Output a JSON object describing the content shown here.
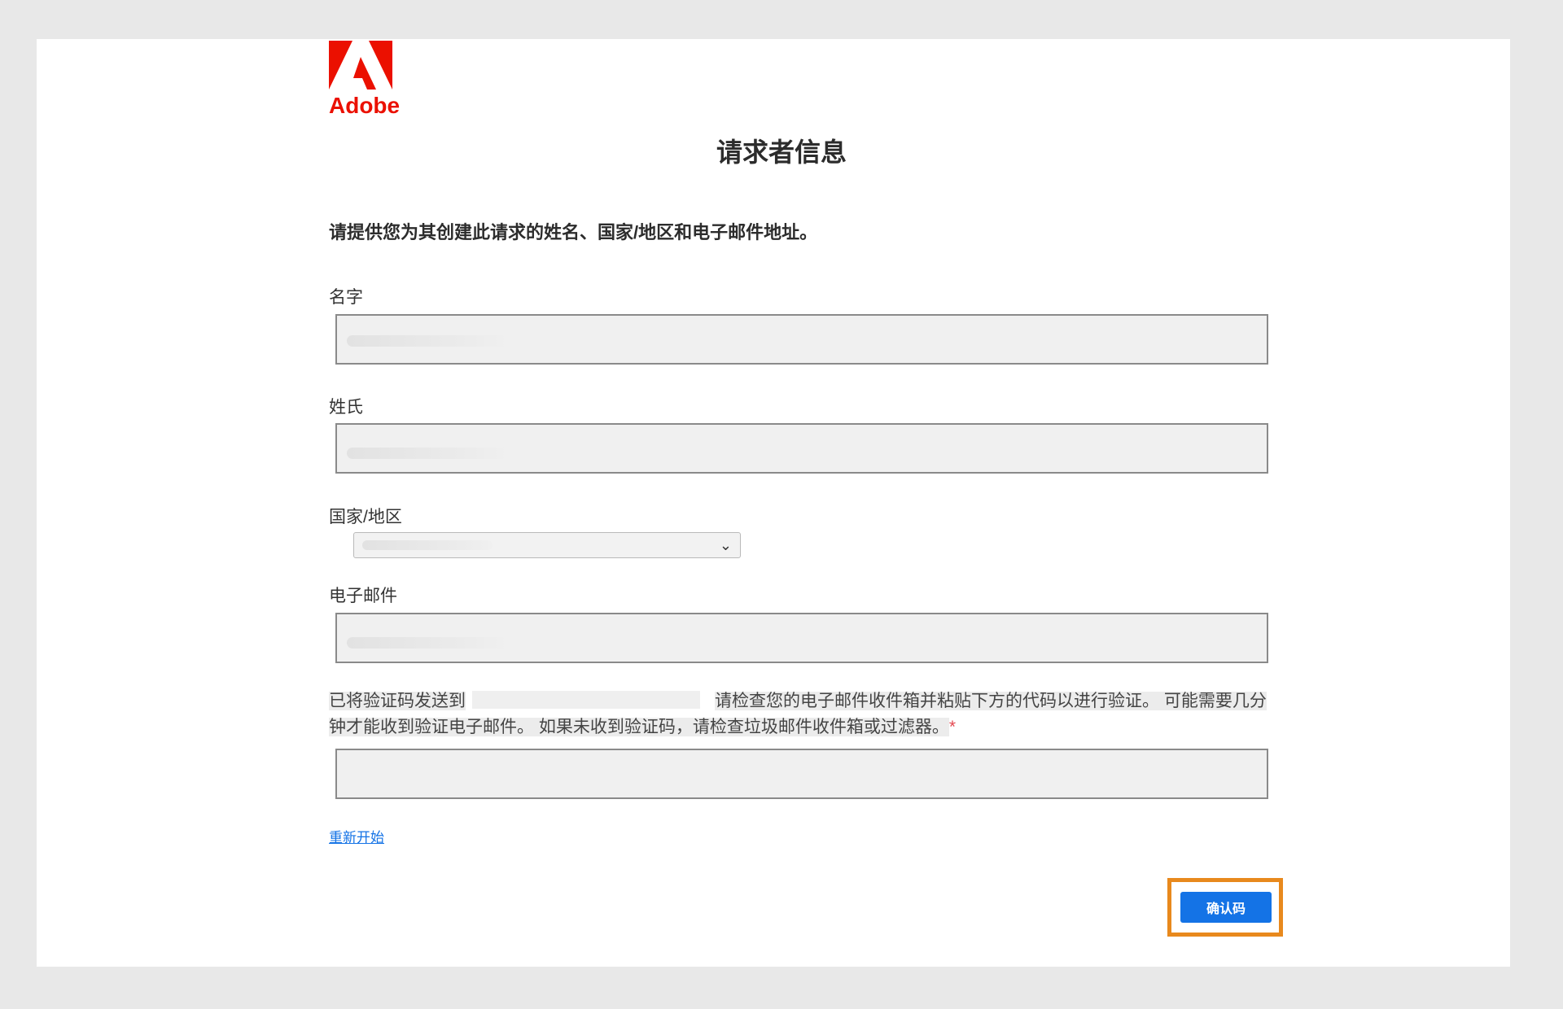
{
  "brand": {
    "name": "Adobe",
    "color": "#eb1000",
    "icon": "adobe-logo-icon"
  },
  "page": {
    "title": "请求者信息",
    "intro": "请提供您为其创建此请求的姓名、国家/地区和电子邮件地址。"
  },
  "form": {
    "first_name": {
      "label": "名字",
      "value": ""
    },
    "last_name": {
      "label": "姓氏",
      "value": ""
    },
    "country": {
      "label": "国家/地区",
      "selected": "",
      "icon": "chevron-down-icon"
    },
    "email": {
      "label": "电子邮件",
      "value": ""
    },
    "verification": {
      "message_part1": "已将验证码发送到",
      "message_part2": "请检查您的电子邮件收件箱并粘贴下方的代码以进行验证。 可能需要几分钟才能收到验证电子邮件。 如果未收到验证码，请检查垃圾邮件收件箱或过滤器。",
      "required_mark": "*",
      "value": ""
    }
  },
  "actions": {
    "restart_label": "重新开始",
    "confirm_label": "确认码"
  },
  "colors": {
    "accent": "#1473e6",
    "highlight_border": "#e8891d",
    "required": "#e34850"
  }
}
